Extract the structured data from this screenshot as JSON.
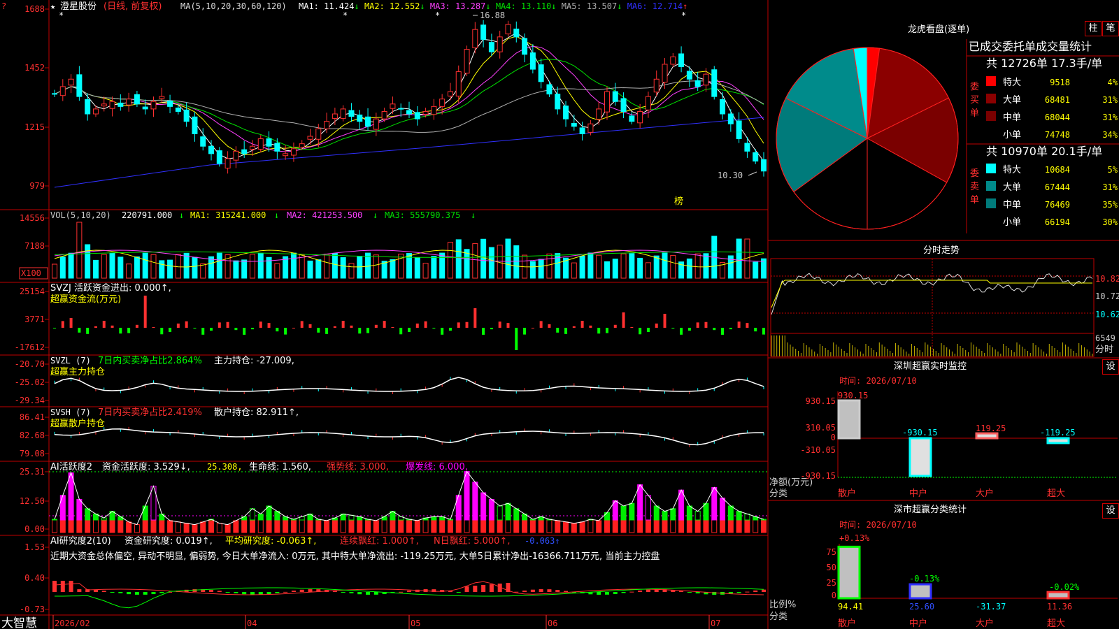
{
  "colors": {
    "up": "#ff3030",
    "down": "#00ffff",
    "frame": "#c00000",
    "ma1": "#ffffff",
    "ma2": "#ffff00",
    "ma3": "#ff40ff",
    "ma4": "#00e000",
    "ma5": "#b0b0b0",
    "ma6": "#3030ff",
    "pink": "#ff00ff",
    "green": "#00ff00",
    "yellow": "#ffff00"
  },
  "header": {
    "star": "★",
    "stock": "澄星股份",
    "mode": "(日线, 前复权)",
    "ma_title": "MA(5,10,20,30,60,120)",
    "ma_values": [
      {
        "label": "MA1:",
        "value": "11.424",
        "arrow": "↓"
      },
      {
        "label": "MA2:",
        "value": "12.552",
        "arrow": "↓"
      },
      {
        "label": "MA3:",
        "value": "13.287",
        "arrow": "↓"
      },
      {
        "label": "MA4:",
        "value": "13.110",
        "arrow": "↓"
      },
      {
        "label": "MA5:",
        "value": "13.507",
        "arrow": "↓"
      },
      {
        "label": "MA6:",
        "value": "12.714",
        "arrow": "↑"
      }
    ],
    "badge": "?"
  },
  "kline_panel": {
    "y_ticks": [
      "1688",
      "1452",
      "1215",
      "979"
    ],
    "high_label": "16.88",
    "low_label": "10.30",
    "bang": "榜"
  },
  "vol_panel": {
    "title": "VOL(5,10,20)",
    "value": "220791.000",
    "ma1": "MA1: 315241.000",
    "ma2": "MA2: 421253.500",
    "ma3": "MA3: 555790.375",
    "down_arrow": "↓",
    "y_ticks": [
      "14556",
      "7188"
    ],
    "unit": "X100"
  },
  "svzj_panel": {
    "title": "SVZJ  活跃资金进出: 0.000↑,",
    "subtitle": "超赢资金流(万元)",
    "y_ticks": [
      "25154",
      "3771",
      "-17612"
    ]
  },
  "svzl_panel": {
    "title": "SVZL (7)",
    "ratio_text": "7日内买卖净占比2.864%",
    "hold_text": "主力持仓: -27.009,",
    "subtitle": "超赢主力持仓",
    "y_ticks": [
      "-20.70",
      "-25.02",
      "-29.34"
    ]
  },
  "svsh_panel": {
    "title": "SVSH (7)",
    "ratio_text": "7日内买卖净占比2.419%",
    "hold_text": "散户持仓: 82.911↑,",
    "subtitle": "超赢散户持仓",
    "y_ticks": [
      "86.41",
      "82.68",
      "79.08"
    ]
  },
  "ai_active_panel": {
    "title": "AI活跃度2",
    "activity": "资金活跃度: 3.529↓,",
    "v2": "25.308,",
    "life": "生命线: 1.560,",
    "strong": "强势线: 3.000,",
    "burst": "爆发线: 6.000,",
    "y_ticks": [
      "25.31",
      "12.50",
      "0.00"
    ]
  },
  "ai_research_panel": {
    "title": "AI研究度2(10)",
    "research": "资金研究度: 0.019↑,",
    "avg": "平均研究度: -0.063↑,",
    "consec": "连续飘红: 1.000↑,",
    "nday": "N日飘红: 5.000↑,",
    "last": "-0.063↑",
    "comment": "近期大资金总体偏空, 异动不明显, 偏弱势, 今日大单净流入: 0万元, 其中特大单净流出: -119.25万元, 大单5日累计净出-16366.711万元, 当前主力控盘",
    "y_ticks": [
      "1.53",
      "0.40",
      "-0.73"
    ]
  },
  "x_axis": {
    "labels": [
      "2026/02",
      "04",
      "05",
      "06",
      "07"
    ],
    "brand": "大智慧"
  },
  "dragon_tiger": {
    "title": "龙虎看盘(逐单)",
    "btn_col": "柱",
    "btn_pen": "笔",
    "table_title": "已成交委托单成交量统计",
    "buy_summary": "共 12726单 17.3手/单",
    "sell_summary": "共 10970单 20.1手/单",
    "buy_side": "委买单",
    "sell_side": "委卖单",
    "buy_rows": [
      {
        "label": "特大",
        "qty": "9518",
        "pct": "4%",
        "color": "#ff0000"
      },
      {
        "label": "大单",
        "qty": "68481",
        "pct": "31%",
        "color": "#8b0000"
      },
      {
        "label": "中单",
        "qty": "68044",
        "pct": "31%",
        "color": "#7a0000"
      },
      {
        "label": "小单",
        "qty": "74748",
        "pct": "34%",
        "color": "#000000"
      }
    ],
    "sell_rows": [
      {
        "label": "特大",
        "qty": "10684",
        "pct": "5%",
        "color": "#00ffff"
      },
      {
        "label": "大单",
        "qty": "67444",
        "pct": "31%",
        "color": "#008b8b"
      },
      {
        "label": "中单",
        "qty": "76469",
        "pct": "35%",
        "color": "#007b7b"
      },
      {
        "label": "小单",
        "qty": "66194",
        "pct": "30%",
        "color": "#000000"
      }
    ]
  },
  "intraday": {
    "title": "分时走势",
    "y_ticks": [
      "10.82",
      "10.72",
      "10.62"
    ],
    "vol_top": "6549",
    "vol_unit": "分时"
  },
  "sz_monitor": {
    "title": "深圳超赢实时监控",
    "btn": "设",
    "time": "时间: 2026/07/10",
    "y_ticks": [
      "930.15",
      "310.05",
      "0",
      "-310.05",
      "-930.15"
    ],
    "y_unit": "净额(万元)",
    "x_unit": "分类",
    "bar_labels": [
      "930.15",
      "-930.15",
      "119.25",
      "-119.25"
    ],
    "categories": [
      "散户",
      "中户",
      "大户",
      "超大"
    ]
  },
  "sz_class": {
    "title": "深市超赢分类统计",
    "btn": "设",
    "time": "时间: 2026/07/10",
    "y_ticks": [
      "75",
      "50",
      "25",
      "0"
    ],
    "y_unit": "比例%",
    "x_unit": "分类",
    "top_labels": [
      "+0.13%",
      "-0.13%",
      "-0.02%"
    ],
    "values": [
      "94.41",
      "25.60",
      "-31.37",
      "11.36"
    ],
    "categories": [
      "散户",
      "中户",
      "大户",
      "超大"
    ]
  },
  "chart_data": [
    {
      "type": "candlestick",
      "title": "澄星股份 (日线, 前复权)",
      "x_labels": [
        "2026/02",
        "04",
        "05",
        "06",
        "07"
      ],
      "ylim": [
        9.79,
        16.88
      ],
      "annotations": {
        "high": 16.88,
        "low": 10.3
      },
      "ohlc_close_approx": [
        13.6,
        13.9,
        14.2,
        13.5,
        12.8,
        13.0,
        13.2,
        13.3,
        13.1,
        13.4,
        13.2,
        13.0,
        13.3,
        13.5,
        13.1,
        12.9,
        12.5,
        12.0,
        11.5,
        11.2,
        10.8,
        11.0,
        11.3,
        11.2,
        11.5,
        11.8,
        11.5,
        11.3,
        11.2,
        11.4,
        11.6,
        11.9,
        12.2,
        12.5,
        12.8,
        13.0,
        12.7,
        12.5,
        12.3,
        12.6,
        12.9,
        13.2,
        13.0,
        12.8,
        12.6,
        12.9,
        13.1,
        13.4,
        13.7,
        14.5,
        15.4,
        16.2,
        15.8,
        15.3,
        15.9,
        16.4,
        15.9,
        15.2,
        14.6,
        14.1,
        13.6,
        13.0,
        12.6,
        12.3,
        12.0,
        12.4,
        13.0,
        13.7,
        13.3,
        12.9,
        12.5,
        12.9,
        13.5,
        14.2,
        14.8,
        15.1,
        14.7,
        14.2,
        13.9,
        14.4,
        13.5,
        12.8,
        12.4,
        11.8,
        11.3,
        10.9,
        10.5
      ]
    },
    {
      "type": "pie",
      "title": "龙虎看盘(逐单)",
      "slices": [
        {
          "name": "委买-特大",
          "value": 9518
        },
        {
          "name": "委买-大单",
          "value": 68481
        },
        {
          "name": "委买-中单",
          "value": 68044
        },
        {
          "name": "委买-小单",
          "value": 74748
        },
        {
          "name": "委卖-小单",
          "value": 66194
        },
        {
          "name": "委卖-中单",
          "value": 76469
        },
        {
          "name": "委卖-大单",
          "value": 67444
        },
        {
          "name": "委卖-特大",
          "value": 10684
        }
      ]
    },
    {
      "type": "bar",
      "title": "深圳超赢实时监控",
      "categories": [
        "散户",
        "中户",
        "大户",
        "超大"
      ],
      "values": [
        930.15,
        -930.15,
        119.25,
        -119.25
      ],
      "ylabel": "净额(万元)",
      "ylim": [
        -930.15,
        930.15
      ]
    },
    {
      "type": "bar",
      "title": "深市超赢分类统计",
      "categories": [
        "散户",
        "中户",
        "大户",
        "超大"
      ],
      "values": [
        94.41,
        25.6,
        -31.37,
        11.36
      ],
      "ylabel": "比例%",
      "ylim": [
        0,
        100
      ]
    }
  ]
}
